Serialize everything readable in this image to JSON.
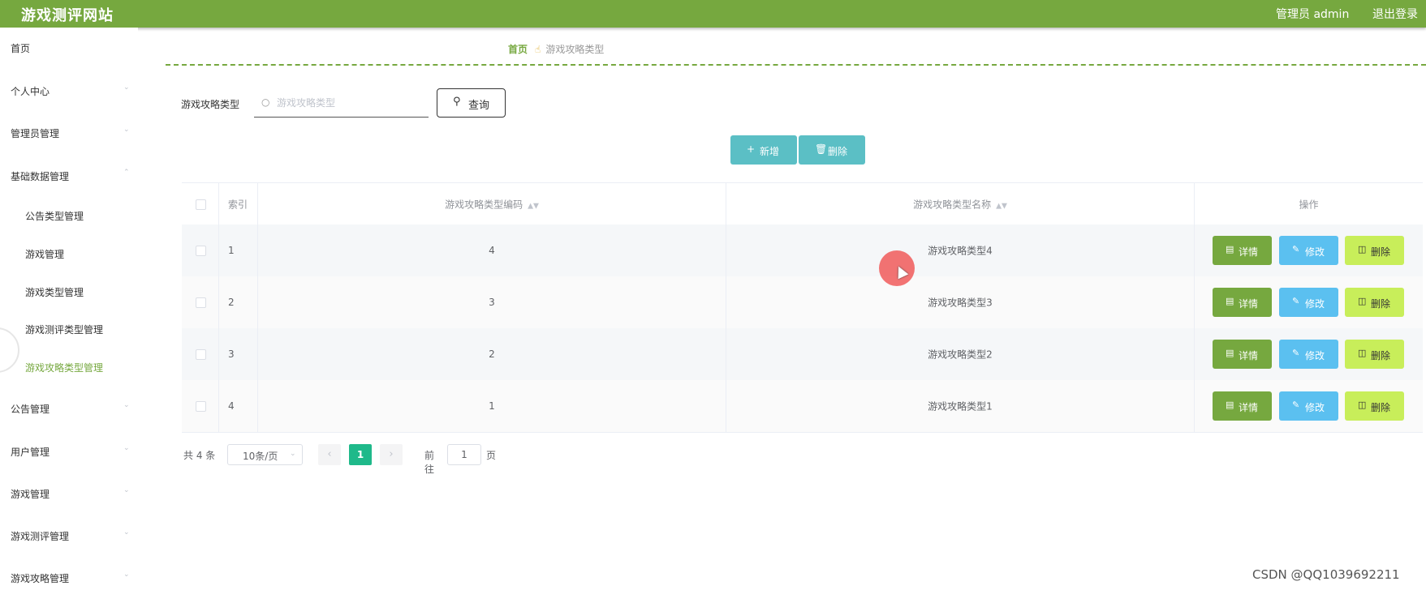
{
  "header": {
    "title": "游戏测评网站",
    "admin_label": "管理员 admin",
    "logout_label": "退出登录"
  },
  "sidebar": {
    "items": [
      {
        "label": "首页"
      },
      {
        "label": "个人中心"
      },
      {
        "label": "管理员管理"
      },
      {
        "label": "基础数据管理"
      },
      {
        "label": "公告类型管理"
      },
      {
        "label": "游戏管理"
      },
      {
        "label": "游戏类型管理"
      },
      {
        "label": "游戏测评类型管理"
      },
      {
        "label": "游戏攻略类型管理"
      },
      {
        "label": "公告管理"
      },
      {
        "label": "用户管理"
      },
      {
        "label": "游戏管理"
      },
      {
        "label": "游戏测评管理"
      },
      {
        "label": "游戏攻略管理"
      }
    ],
    "active": "游戏攻略类型管理"
  },
  "breadcrumb": {
    "home": "首页",
    "current": "游戏攻略类型"
  },
  "search": {
    "label": "游戏攻略类型",
    "placeholder": "游戏攻略类型",
    "value": "",
    "query_button": "查询"
  },
  "actions": {
    "add_label": "新增",
    "delete_label": "删除",
    "color": "#5bbfc5"
  },
  "table": {
    "headers": {
      "index": "索引",
      "code": "游戏攻略类型编码",
      "name": "游戏攻略类型名称",
      "ops": "操作"
    },
    "rows": [
      {
        "index": "1",
        "code": "4",
        "name": "游戏攻略类型4"
      },
      {
        "index": "2",
        "code": "3",
        "name": "游戏攻略类型3"
      },
      {
        "index": "3",
        "code": "2",
        "name": "游戏攻略类型2"
      },
      {
        "index": "4",
        "code": "1",
        "name": "游戏攻略类型1"
      }
    ],
    "row_buttons": {
      "detail": "详情",
      "edit": "修改",
      "delete": "删除"
    }
  },
  "pagination": {
    "total_text": "共 4 条",
    "page_size": "10条/页",
    "current_page": "1",
    "goto_prefix": "前往",
    "goto_value": "1",
    "goto_suffix": "页"
  },
  "colors": {
    "brand_green": "#76a83f",
    "page_active": "#1fb98a",
    "edit_blue": "#5bc0f0",
    "delete_lime": "#c8ee5a"
  },
  "watermark": "CSDN @QQ1039692211"
}
